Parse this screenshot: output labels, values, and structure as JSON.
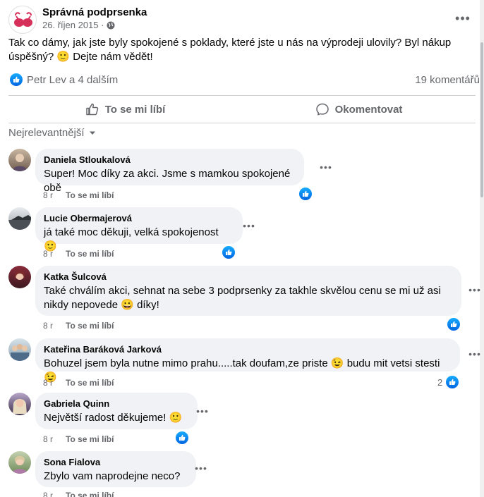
{
  "post": {
    "page_name": "Správná podprsenka",
    "date": "26. říjen 2015 ·",
    "text": "Tak co dámy, jak jste byly spokojené s poklady, které jste u nás na výprodeji ulovily? Byl nákup úspěšný? 🙂 Dejte nám vědět!",
    "reactors": "Petr Lev a 4 dalším",
    "comment_count": "19 komentářů"
  },
  "actions": {
    "like": "To se mi líbí",
    "comment": "Okomentovat"
  },
  "sort_label": "Nejrelevantnější",
  "comments": [
    {
      "name": "Daniela Stloukalová",
      "text": "Super! Moc díky za akci. Jsme s mamkou spokojené obě",
      "age": "8 r",
      "like": "To se mi líbí",
      "reactions": ""
    },
    {
      "name": "Lucie Obermajerová",
      "text": "já také moc děkuji, velká spokojenost 🙂",
      "age": "8 r",
      "like": "To se mi líbí",
      "reactions": ""
    },
    {
      "name": "Katka Šulcová",
      "text": "Také chválím akci, sehnat na sebe 3 podprsenky za takhle skvělou cenu se mi už asi nikdy nepovede 😀 díky!",
      "age": "8 r",
      "like": "To se mi líbí",
      "reactions": ""
    },
    {
      "name": "Kateřina Baráková Jarková",
      "text": "Bohuzel jsem byla nutne mimo prahu.....tak doufam,ze priste 😉 budu mit vetsi stesti 😉",
      "age": "8 r",
      "like": "To se mi líbí",
      "reactions": "2"
    },
    {
      "name": "Gabriela Quinn",
      "text": "Největší radost děkujeme! 🙂",
      "age": "8 r",
      "like": "To se mi líbí",
      "reactions": ""
    },
    {
      "name": "Sona Fialova",
      "text": "Zbylo vam naprodejne neco?",
      "age": "8 r",
      "like": "To se mi líbí",
      "reactions": ""
    }
  ],
  "colors": {
    "like_blue": "#0866ff",
    "bubble_bg": "#f0f2f5",
    "secondary_text": "#65676b"
  },
  "icons": [
    "globe-icon",
    "like-icon",
    "comment-icon",
    "chevron-down-icon",
    "more-icon"
  ]
}
